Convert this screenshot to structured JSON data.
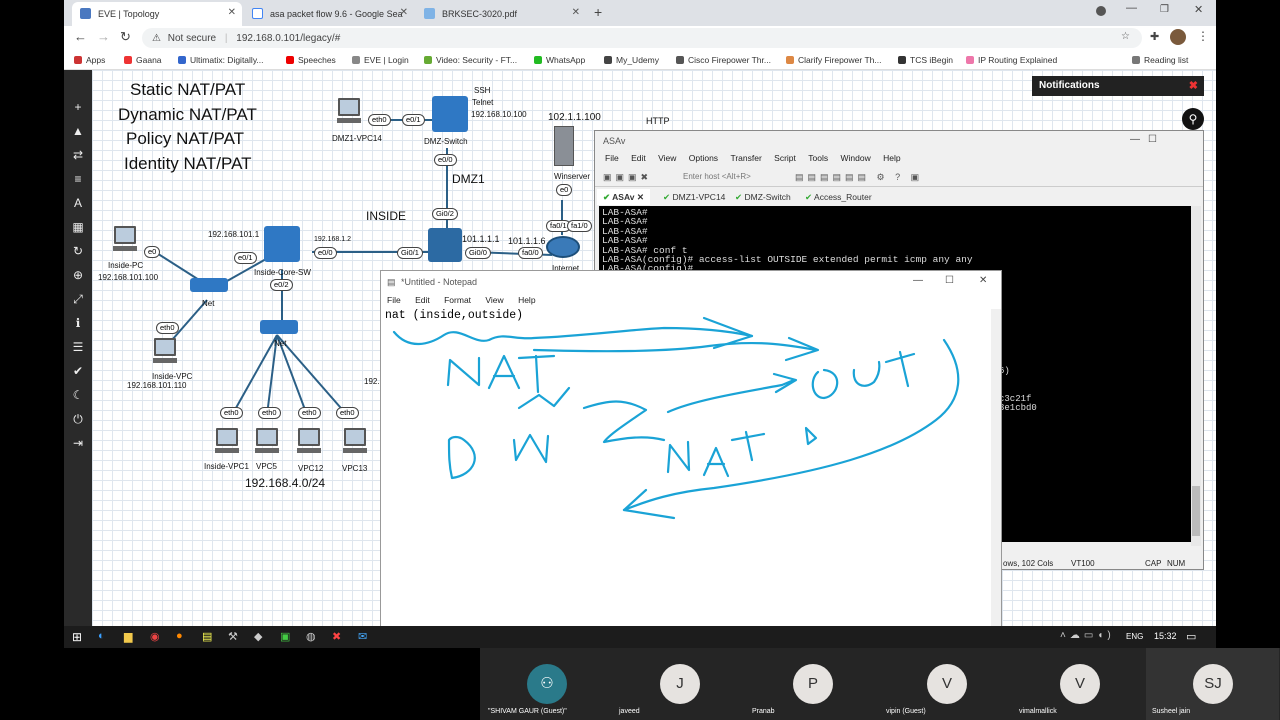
{
  "browser": {
    "tabs": [
      {
        "title": "EVE | Topology",
        "active": true
      },
      {
        "title": "asa packet flow 9.6 - Google Sea",
        "active": false
      },
      {
        "title": "BRKSEC-3020.pdf",
        "active": false
      }
    ],
    "security_label": "Not secure",
    "url": "192.168.0.101/legacy/#",
    "bookmarks": [
      "Apps",
      "Gaana",
      "Ultimatix: Digitally...",
      "Speeches",
      "EVE | Login",
      "Video: Security - FT...",
      "WhatsApp",
      "My_Udemy",
      "Cisco Firepower Thr...",
      "Clarify Firepower Th...",
      "TCS iBegin",
      "IP Routing Explained"
    ],
    "reading_list": "Reading list"
  },
  "eve": {
    "notifications_title": "Notifications",
    "nat_types": [
      "Static NAT/PAT",
      "Dynamic NAT/PAT",
      "Policy NAT/PAT",
      "Identity NAT/PAT"
    ],
    "labels": {
      "dmz1_vpc14": "DMZ1-VPC14",
      "dmz_switch": "DMZ-Switch",
      "ssh": "SSH",
      "telnet": "Telnet",
      "dmz_ip": "192.168.10.100",
      "web_ip": "102.1.1.100",
      "http": "HTTP",
      "winserver": "Winserver",
      "dmz1": "DMZ1",
      "inside": "INSIDE",
      "inside_pc": "Inside-PC",
      "inside_pc_ip": "192.168.101.100",
      "inside_core_sw": "Inside-Core-SW",
      "core_ip": "192.168.101.1",
      "asa_in_ip": "192.168.1.2",
      "asa_out_ip": "101.1.1.1",
      "router_ip": "101.1.1.6",
      "internet": "Internet",
      "net1": "Net",
      "net2": "Net",
      "inside_vpc": "Inside-VPC",
      "inside_vpc_ip": "192.168.101.110",
      "vpc_names": [
        "Inside-VPC1",
        "VPC5",
        "VPC12",
        "VPC13"
      ],
      "subnet": "192.168.4.0/24",
      "partial_ip": "192."
    },
    "ports": {
      "eth0_a": "eth0",
      "e0_1_a": "e0/1",
      "e0_0_a": "e0/0",
      "gi0_2": "Gi0/2",
      "e0_srv": "e0",
      "e0_pc": "e0",
      "e0_1_b": "e0/1",
      "e0_0_b": "e0/0",
      "gi0_1": "Gi0/1",
      "gi0_0": "Gi0/0",
      "fa0_0": "fa0/0",
      "fa0_1": "fa0/1",
      "fa1_0": "fa1/0",
      "e0_2": "e0/2",
      "eth0_vpc": "eth0",
      "eth0_1": "eth0",
      "eth0_2": "eth0",
      "eth0_3": "eth0",
      "eth0_4": "eth0"
    }
  },
  "asav": {
    "title": "ASAv",
    "menu": [
      "File",
      "Edit",
      "View",
      "Options",
      "Transfer",
      "Script",
      "Tools",
      "Window",
      "Help"
    ],
    "host_placeholder": "Enter host <Alt+R>",
    "tabs": [
      "ASAv",
      "DMZ1-VPC14",
      "DMZ-Switch",
      "Access_Router"
    ],
    "lines": [
      "LAB-ASA#",
      "LAB-ASA#",
      "LAB-ASA#",
      "LAB-ASA#",
      "LAB-ASA# conf t",
      "LAB-ASA(config)# access-list OUTSIDE extended permit icmp any any",
      "LAB-ASA(config)#"
    ],
    "partial_lines": [
      "6)",
      "c3c21f",
      "3e1cbd0"
    ],
    "status": {
      "rows_cols": "ows, 102 Cols",
      "term": "VT100",
      "caps": "CAP",
      "num": "NUM"
    }
  },
  "notepad": {
    "title": "*Untitled - Notepad",
    "menu": [
      "File",
      "Edit",
      "Format",
      "View",
      "Help"
    ],
    "text": "nat (inside,outside)",
    "ink_color": "#1aa3d6"
  },
  "taskbar": {
    "lang": "ENG",
    "time": "15:32"
  },
  "meeting": {
    "participants": [
      {
        "initials": "",
        "name": "\"SHIVAM GAUR (Guest)\"",
        "self": true
      },
      {
        "initials": "J",
        "name": "javeed"
      },
      {
        "initials": "P",
        "name": "Pranab"
      },
      {
        "initials": "V",
        "name": "vipin (Guest)"
      },
      {
        "initials": "V",
        "name": "vimalmallick"
      },
      {
        "initials": "SJ",
        "name": "Susheel jain"
      }
    ]
  }
}
